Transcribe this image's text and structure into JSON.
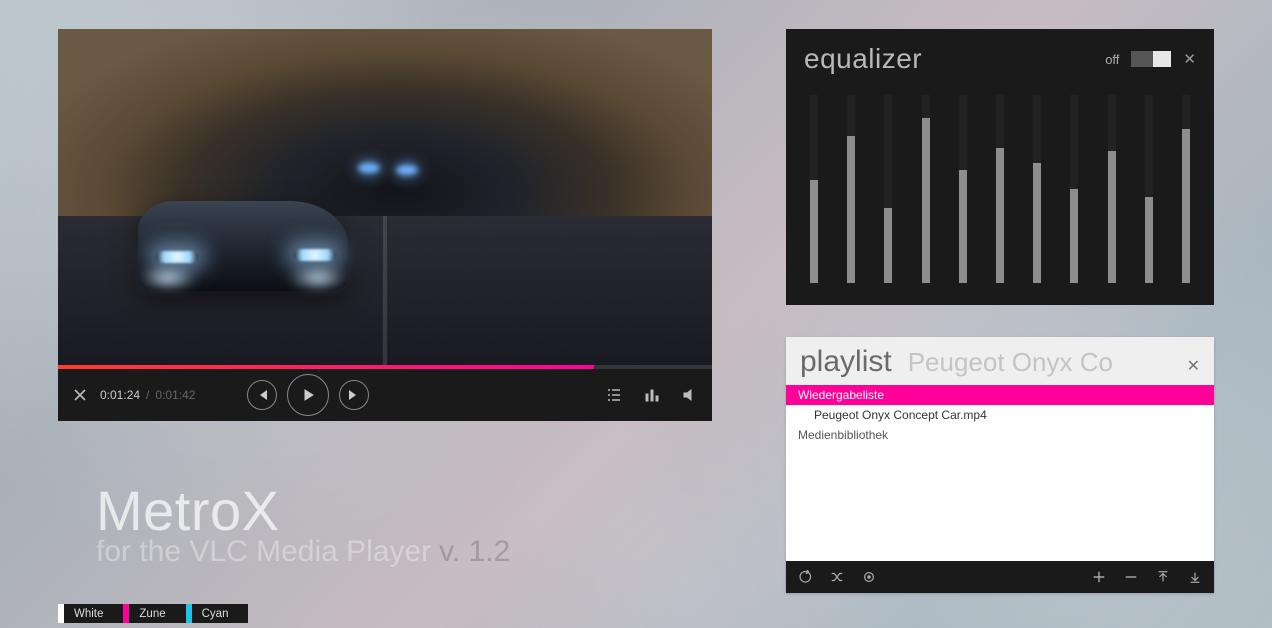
{
  "player": {
    "current_time": "0:01:24",
    "separator": "/",
    "duration": "0:01:42",
    "progress_percent": 82,
    "progress_gradient": [
      "#ff3d2e",
      "#ff0099"
    ]
  },
  "equalizer": {
    "title": "equalizer",
    "state_label": "off",
    "bands_percent": [
      55,
      78,
      40,
      88,
      60,
      72,
      64,
      50,
      70,
      46,
      82
    ]
  },
  "playlist": {
    "title": "playlist",
    "subtitle": "Peugeot Onyx Co",
    "items": [
      {
        "label": "Wiedergabeliste",
        "active": true,
        "indent": false
      },
      {
        "label": "Peugeot Onyx Concept Car.mp4",
        "active": false,
        "indent": true
      },
      {
        "label": "Medienbibliothek",
        "active": false,
        "indent": false
      }
    ]
  },
  "brand": {
    "name": "MetroX",
    "subtitle": "for the VLC Media Player",
    "version": "v. 1.2"
  },
  "themes": [
    {
      "label": "White",
      "color": "#ffffff"
    },
    {
      "label": "Zune",
      "color": "#ff0099"
    },
    {
      "label": "Cyan",
      "color": "#1ec3e6"
    }
  ]
}
